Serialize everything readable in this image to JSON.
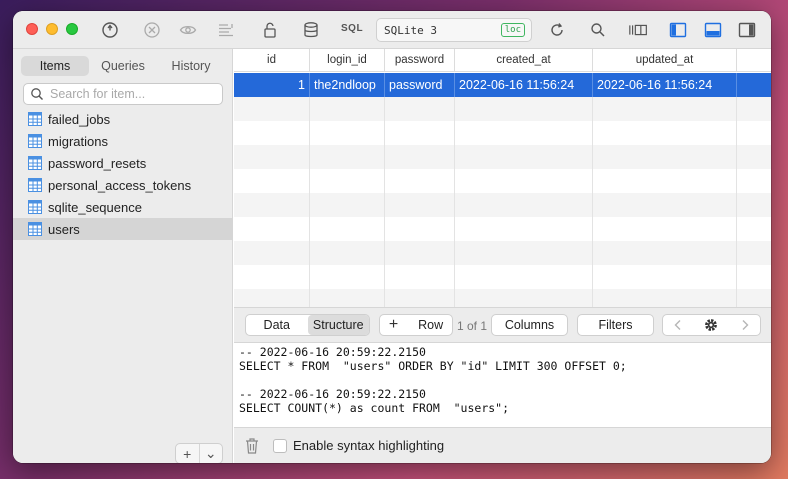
{
  "toolbar": {
    "sql_label": "SQL",
    "connection_name": "SQLite 3",
    "connection_badge": "loc"
  },
  "sidebar": {
    "tabs": [
      {
        "label": "Items",
        "active": true
      },
      {
        "label": "Queries",
        "active": false
      },
      {
        "label": "History",
        "active": false
      }
    ],
    "search_placeholder": "Search for item...",
    "tables": [
      {
        "label": "failed_jobs",
        "selected": false
      },
      {
        "label": "migrations",
        "selected": false
      },
      {
        "label": "password_resets",
        "selected": false
      },
      {
        "label": "personal_access_tokens",
        "selected": false
      },
      {
        "label": "sqlite_sequence",
        "selected": false
      },
      {
        "label": "users",
        "selected": true
      }
    ],
    "add_label": "+",
    "menu_label": "⌄"
  },
  "grid": {
    "columns": [
      "id",
      "login_id",
      "password",
      "created_at",
      "updated_at"
    ],
    "rows": [
      [
        "1",
        "the2ndloop",
        "password",
        "2022-06-16 11:56:24",
        "2022-06-16 11:56:24"
      ]
    ],
    "selected_row": 0
  },
  "bottom_bar": {
    "tabs": [
      {
        "label": "Data",
        "active": false
      },
      {
        "label": "Structure",
        "active": true
      }
    ],
    "add_row_label": "Row",
    "add_row_plus": "+",
    "pager": "1 of 1",
    "columns_label": "Columns",
    "filters_label": "Filters"
  },
  "console": {
    "lines": [
      "-- 2022-06-16 20:59:22.2150",
      "SELECT * FROM  \"users\" ORDER BY \"id\" LIMIT 300 OFFSET 0;",
      "",
      "-- 2022-06-16 20:59:22.2150",
      "SELECT COUNT(*) as count FROM  \"users\";"
    ],
    "syntax_highlight_label": "Enable syntax highlighting",
    "syntax_highlight_checked": false
  },
  "colors": {
    "selection": "#2469d9",
    "accent_blue": "#1f6fe0",
    "badge_green": "#2da24e",
    "table_icon": "#4a90e2"
  }
}
